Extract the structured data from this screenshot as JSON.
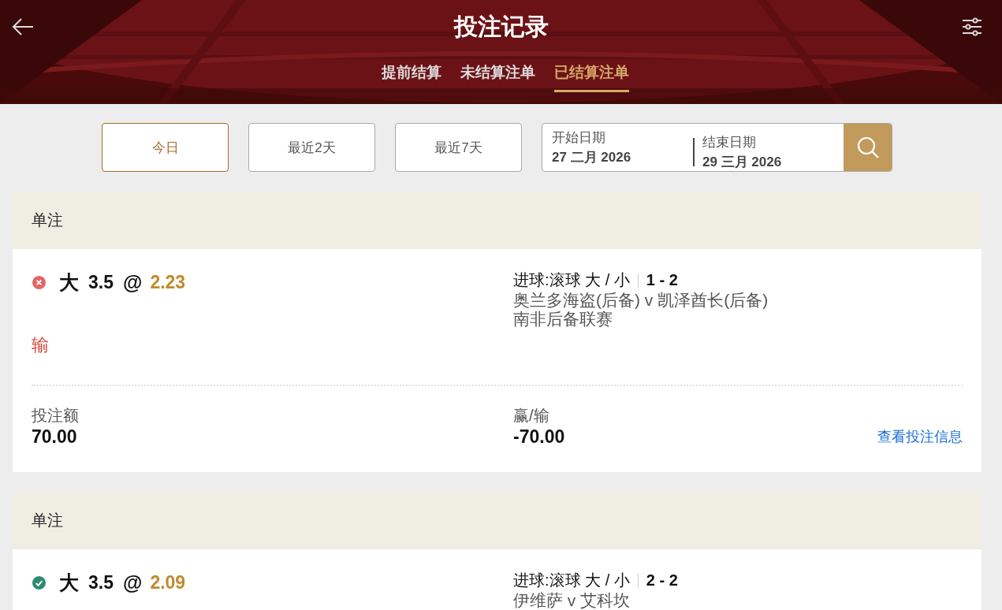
{
  "header": {
    "title": "投注记录"
  },
  "tabs": [
    {
      "label": "提前结算",
      "selected": false
    },
    {
      "label": "未结算注单",
      "selected": false
    },
    {
      "label": "已结算注单",
      "selected": true
    }
  ],
  "filters": [
    {
      "label": "今日",
      "selected": true
    },
    {
      "label": "最近2天",
      "selected": false
    },
    {
      "label": "最近7天",
      "selected": false
    }
  ],
  "date_range": {
    "start_label": "开始日期",
    "start_value": "27 二月 2026",
    "end_label": "结束日期",
    "end_value": "29 三月 2026"
  },
  "bets": [
    {
      "type": "单注",
      "kind": "lost",
      "selection": "大",
      "line": "3.5",
      "at": "@",
      "odds": "2.23",
      "market": "进球:滚球 大 / 小",
      "score": "1 - 2",
      "teams": "奥兰多海盗(后备) v 凯泽酋长(后备)",
      "league": "南非后备联赛",
      "result": "输",
      "stake_label": "投注额",
      "stake": "70.00",
      "winloss_label": "赢/输",
      "winloss": "-70.00",
      "link": "查看投注信息"
    },
    {
      "type": "单注",
      "kind": "won",
      "selection": "大",
      "line": "3.5",
      "at": "@",
      "odds": "2.09",
      "market": "进球:滚球 大 / 小",
      "score": "2 - 2",
      "teams": "伊维萨 v 艾科坎"
    }
  ]
}
